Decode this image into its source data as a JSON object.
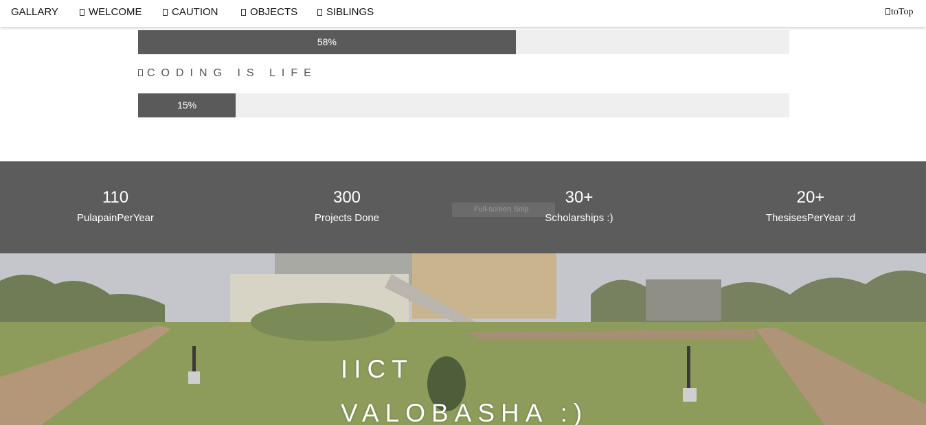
{
  "nav": {
    "items": [
      {
        "label": "GALLARY",
        "icon": ""
      },
      {
        "label": "WELCOME",
        "icon": "glyph-icon"
      },
      {
        "label": "CAUTION",
        "icon": "glyph-icon"
      },
      {
        "label": "OBJECTS",
        "icon": "glyph-icon"
      },
      {
        "label": "SIBLINGS",
        "icon": "glyph-icon"
      }
    ],
    "to_top": "toTop"
  },
  "skills": [
    {
      "title": "",
      "percent": 58,
      "label": "58%"
    },
    {
      "title": "CODING IS LIFE",
      "percent": 15,
      "label": "15%"
    }
  ],
  "stats": [
    {
      "number": "110",
      "label": "PulapainPerYear"
    },
    {
      "number": "300",
      "label": "Projects Done"
    },
    {
      "number": "30+",
      "label": "Scholarships :)"
    },
    {
      "number": "20+",
      "label": "ThesisesPerYear :d"
    }
  ],
  "overlay": {
    "snip_label": "Full-screen Snip"
  },
  "hero": {
    "line1": "IICT",
    "line2": "VALOBASHA :)"
  },
  "colors": {
    "bar_fill": "#5a5a5a",
    "bar_track": "#efefef",
    "stats_bg": "#5c5c5c",
    "nav_bg": "#ffffff"
  }
}
